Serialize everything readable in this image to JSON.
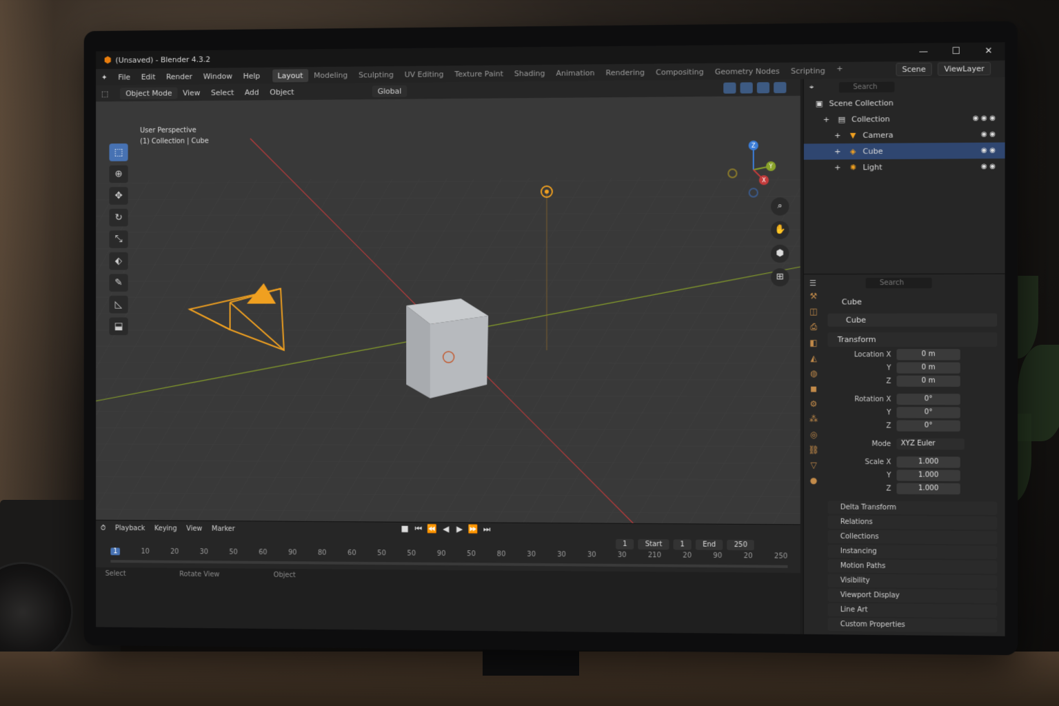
{
  "window": {
    "title": "(Unsaved) - Blender 4.3.2",
    "controls": [
      "—",
      "☐",
      "✕"
    ]
  },
  "menu": {
    "items": [
      "File",
      "Edit",
      "Render",
      "Window",
      "Help"
    ],
    "workspaces": [
      "Layout",
      "Modeling",
      "Sculpting",
      "UV Editing",
      "Texture Paint",
      "Shading",
      "Animation",
      "Rendering",
      "Compositing",
      "Geometry Nodes",
      "Scripting"
    ],
    "active_workspace": "Layout",
    "add_workspace": "+",
    "scene": "Scene",
    "view_layer": "ViewLayer"
  },
  "viewport": {
    "mode": "Object Mode",
    "menus": [
      "View",
      "Select",
      "Add",
      "Object"
    ],
    "transform_orientation": "Global",
    "perspective_label": "User Perspective",
    "collection_label": "(1) Collection | Cube",
    "tools": [
      "select-box",
      "cursor",
      "move",
      "rotate",
      "scale",
      "transform",
      "annotate",
      "measure",
      "add-cube"
    ],
    "gizmo_axes": [
      "Z",
      "Y",
      "X"
    ]
  },
  "timeline": {
    "menus": [
      "Playback",
      "Keying",
      "View",
      "Marker"
    ],
    "current_frame": "1",
    "start_label": "Start",
    "start_value": "1",
    "end_label": "End",
    "end_value": "250",
    "ruler": [
      "1",
      "10",
      "20",
      "30",
      "50",
      "60",
      "90",
      "80",
      "60",
      "50",
      "50",
      "90",
      "50",
      "80",
      "30",
      "30",
      "30",
      "30",
      "210",
      "20",
      "90",
      "20",
      "250"
    ]
  },
  "statusbar": {
    "items": [
      "Select",
      "Rotate View",
      "Object"
    ]
  },
  "outliner": {
    "search_placeholder": "Search",
    "root": "Scene Collection",
    "collection": "Collection",
    "objects": [
      {
        "name": "Camera",
        "selected": false
      },
      {
        "name": "Cube",
        "selected": true
      },
      {
        "name": "Light",
        "selected": false
      }
    ]
  },
  "properties": {
    "search_placeholder": "Search",
    "object_title": "Cube",
    "object_name": "Cube",
    "transform_header": "Transform",
    "location": {
      "label": "Location X",
      "x": "0 m",
      "y": "0 m",
      "z": "0 m"
    },
    "rotation": {
      "label": "Rotation X",
      "x": "0°",
      "y": "0°",
      "z": "0°"
    },
    "mode_label": "Mode",
    "mode_value": "XYZ Euler",
    "scale": {
      "label": "Scale X",
      "x": "1.000",
      "y": "1.000",
      "z": "1.000"
    },
    "axis_y": "Y",
    "axis_z": "Z",
    "panels": [
      "Delta Transform",
      "Relations",
      "Collections",
      "Instancing",
      "Motion Paths",
      "Visibility",
      "Viewport Display",
      "Line Art",
      "Custom Properties"
    ]
  },
  "colors": {
    "accent": "#4772b3",
    "selection": "#2f4670",
    "camera": "#f0a020",
    "light": "#f0a020",
    "x_axis": "#c23b3b",
    "y_axis": "#8aa32a"
  }
}
